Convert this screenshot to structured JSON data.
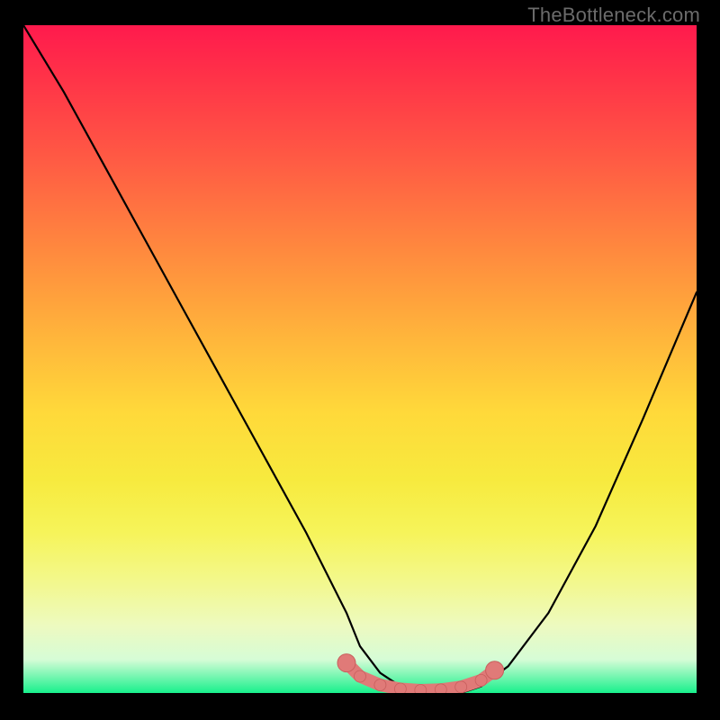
{
  "watermark": "TheBottleneck.com",
  "colors": {
    "background": "#000000",
    "curve": "#000000",
    "marker_fill": "#e07a78",
    "marker_stroke": "#c85f5d"
  },
  "chart_data": {
    "type": "line",
    "title": "",
    "xlabel": "",
    "ylabel": "",
    "xlim": [
      0,
      100
    ],
    "ylim": [
      0,
      100
    ],
    "series": [
      {
        "name": "bottleneck-curve",
        "x": [
          0,
          6,
          12,
          18,
          24,
          30,
          36,
          42,
          48,
          50,
          53,
          56,
          59,
          62,
          65,
          68,
          72,
          78,
          85,
          92,
          100
        ],
        "y": [
          100,
          90,
          79,
          68,
          57,
          46,
          35,
          24,
          12,
          7,
          3,
          1,
          0,
          0,
          0,
          1,
          4,
          12,
          25,
          41,
          60
        ]
      }
    ],
    "markers": {
      "name": "optimal-range",
      "x": [
        48,
        50,
        53,
        56,
        59,
        62,
        65,
        68,
        70
      ],
      "y": [
        4.5,
        2.5,
        1.2,
        0.6,
        0.4,
        0.5,
        0.9,
        1.9,
        3.4
      ]
    }
  }
}
